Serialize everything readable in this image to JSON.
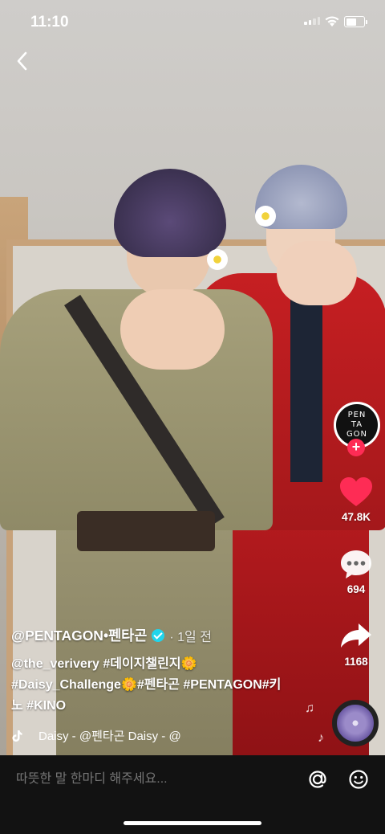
{
  "status_bar": {
    "time": "11:10",
    "signal_bars": 4,
    "signal_active": 2,
    "battery_level": 0.6
  },
  "nav": {
    "back_icon": "chevron-left-icon"
  },
  "actions": {
    "avatar_lines": [
      "PEN",
      "TA",
      "GON"
    ],
    "follow_symbol": "+",
    "like_count": "47.8K",
    "comment_count": "694",
    "share_count": "1168"
  },
  "caption": {
    "author": "@PENTAGON•펜타곤",
    "posted_ago": "· 1일 전",
    "line1": "@the_verivery #데이지챌린지🌼",
    "line2": "#Daisy_Challenge🌼#펜타곤 #PENTAGON#키",
    "line3": "노 #KINO"
  },
  "music": {
    "icon": "tiktok-note-icon",
    "text": "Daisy - @펜타곤    Daisy - @"
  },
  "comment_bar": {
    "placeholder": "따뜻한 말 한마디 해주세요..."
  },
  "colors": {
    "like": "#fe2c55",
    "verified": "#20d5ec",
    "bottom_bar": "#121212"
  }
}
